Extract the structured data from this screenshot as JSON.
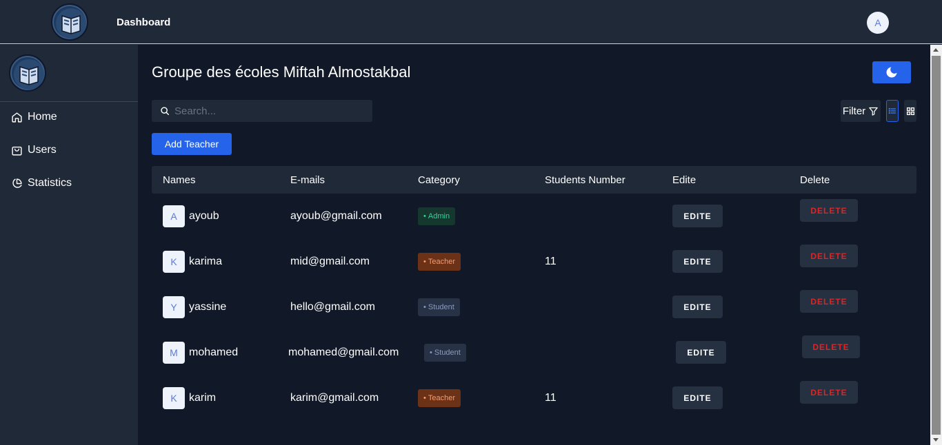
{
  "header": {
    "title": "Dashboard",
    "avatar_initial": "A"
  },
  "sidebar": {
    "items": [
      {
        "label": "Home",
        "icon": "home-icon"
      },
      {
        "label": "Users",
        "icon": "shopping-bag-icon"
      },
      {
        "label": "Statistics",
        "icon": "pie-chart-icon"
      }
    ]
  },
  "main": {
    "title": "Groupe des écoles Miftah Almostakbal",
    "search_placeholder": "Search...",
    "filter_label": "Filter",
    "add_button": "Add Teacher",
    "columns": [
      "Names",
      "E-mails",
      "Category",
      "Students Number",
      "Edite",
      "Delete"
    ],
    "rows": [
      {
        "initial": "A",
        "name": "ayoub",
        "email": "ayoub@gmail.com",
        "category": "Admin",
        "students": "",
        "edit": "EDITE",
        "delete": "DELETE"
      },
      {
        "initial": "K",
        "name": "karima",
        "email": "mid@gmail.com",
        "category": "Teacher",
        "students": "11",
        "edit": "EDITE",
        "delete": "DELETE"
      },
      {
        "initial": "Y",
        "name": "yassine",
        "email": "hello@gmail.com",
        "category": "Student",
        "students": "",
        "edit": "EDITE",
        "delete": "DELETE"
      },
      {
        "initial": "M",
        "name": "mohamed",
        "email": "mohamed@gmail.com",
        "category": "Student",
        "students": "",
        "edit": "EDITE",
        "delete": "DELETE"
      },
      {
        "initial": "K",
        "name": "karim",
        "email": "karim@gmail.com",
        "category": "Teacher",
        "students": "11",
        "edit": "EDITE",
        "delete": "DELETE"
      }
    ]
  },
  "colors": {
    "background": "#111827",
    "panel": "#1f2937",
    "accent": "#2563eb",
    "danger": "#dc2626",
    "admin": "#34d399",
    "teacher": "#fb9a6a",
    "student": "#8b9bbf"
  }
}
